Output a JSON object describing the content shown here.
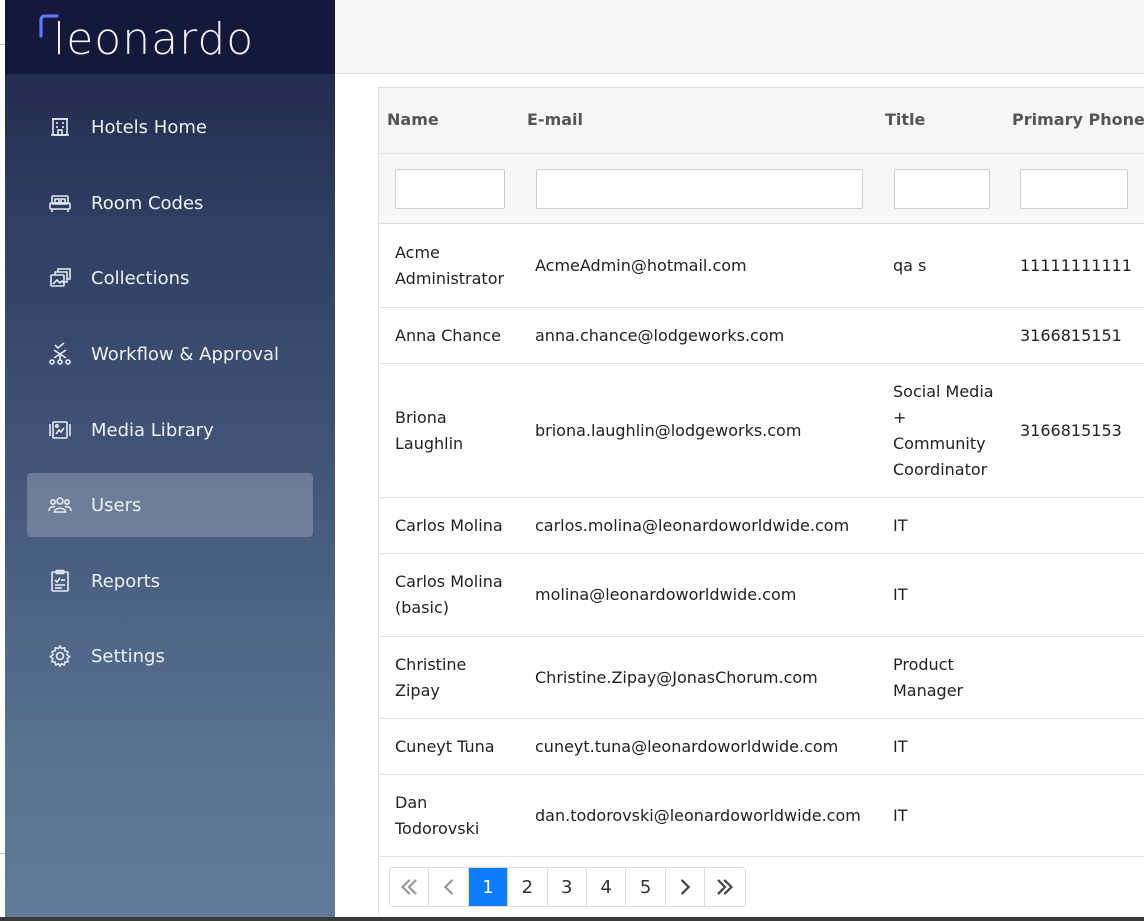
{
  "brand": {
    "name": "leonardo",
    "accent": "#4d6cf5"
  },
  "sidebar": {
    "items": [
      {
        "label": "Hotels Home",
        "icon": "hotel-icon",
        "active": false
      },
      {
        "label": "Room Codes",
        "icon": "bed-icon",
        "active": false
      },
      {
        "label": "Collections",
        "icon": "collections-icon",
        "active": false
      },
      {
        "label": "Workflow & Approval",
        "icon": "workflow-icon",
        "active": false
      },
      {
        "label": "Media Library",
        "icon": "media-icon",
        "active": false
      },
      {
        "label": "Users",
        "icon": "users-icon",
        "active": true
      },
      {
        "label": "Reports",
        "icon": "reports-icon",
        "active": false
      },
      {
        "label": "Settings",
        "icon": "gear-icon",
        "active": false
      }
    ]
  },
  "table": {
    "columns": [
      "Name",
      "E-mail",
      "Title",
      "Primary Phone"
    ],
    "rows": [
      {
        "name": "Acme Administrator",
        "email": "AcmeAdmin@hotmail.com",
        "title": "qa s",
        "phone": "11111111111"
      },
      {
        "name": "Anna Chance",
        "email": "anna.chance@lodgeworks.com",
        "title": "",
        "phone": "3166815151"
      },
      {
        "name": "Briona Laughlin",
        "email": "briona.laughlin@lodgeworks.com",
        "title": "Social Media + Community Coordinator",
        "phone": "3166815153"
      },
      {
        "name": "Carlos Molina",
        "email": "carlos.molina@leonardoworldwide.com",
        "title": "IT",
        "phone": ""
      },
      {
        "name": "Carlos Molina (basic)",
        "email": "molina@leonardoworldwide.com",
        "title": "IT",
        "phone": ""
      },
      {
        "name": "Christine Zipay",
        "email": "Christine.Zipay@JonasChorum.com",
        "title": "Product Manager",
        "phone": ""
      },
      {
        "name": "Cuneyt Tuna",
        "email": "cuneyt.tuna@leonardoworldwide.com",
        "title": "IT",
        "phone": ""
      },
      {
        "name": "Dan Todorovski",
        "email": "dan.todorovski@leonardoworldwide.com",
        "title": "IT",
        "phone": ""
      }
    ]
  },
  "pagination": {
    "pages": [
      "1",
      "2",
      "3",
      "4",
      "5"
    ],
    "current": "1",
    "active_color": "#0d7bff"
  }
}
